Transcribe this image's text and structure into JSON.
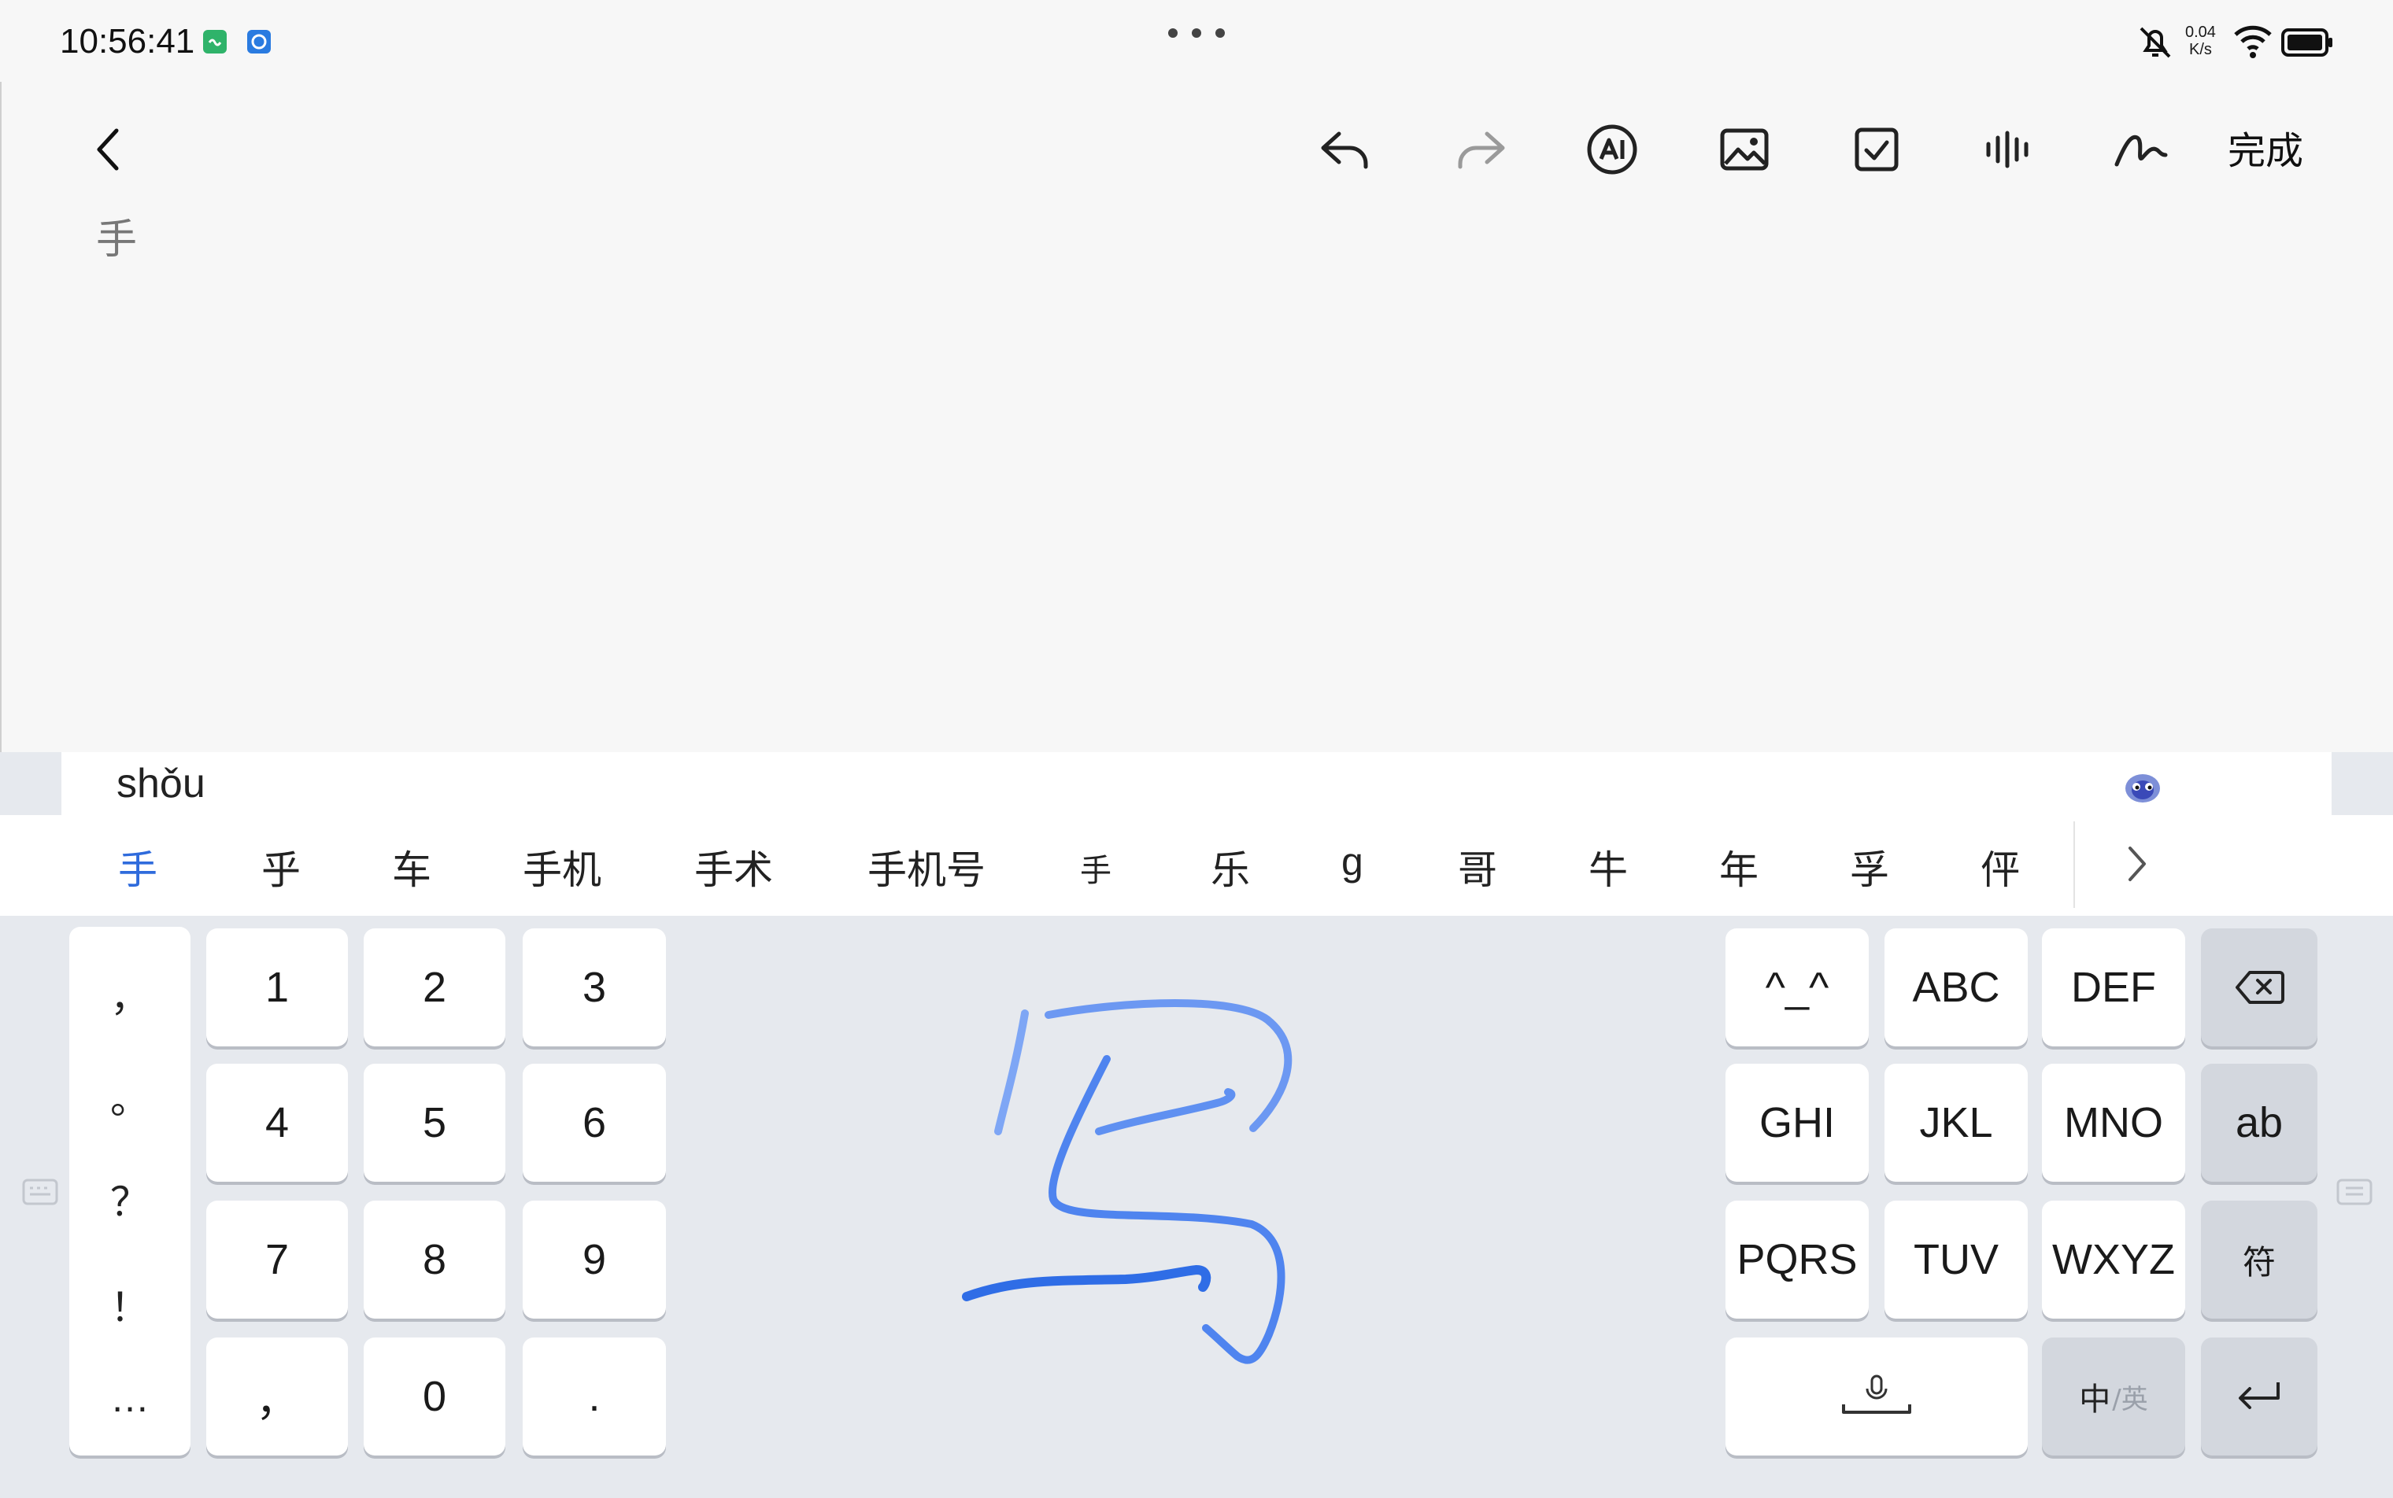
{
  "status_bar": {
    "time": "10:56:41",
    "net_speed_value": "0.04",
    "net_speed_unit": "K/s",
    "icons": [
      "app-badge-green-icon",
      "app-badge-blue-icon",
      "mute-bell-icon",
      "wifi-icon",
      "battery-icon"
    ]
  },
  "toolbar": {
    "back_icon": "chevron-left-icon",
    "tools": [
      "undo-icon",
      "redo-icon",
      "ai-icon",
      "image-icon",
      "checkbox-icon",
      "voice-wave-icon",
      "handwriting-icon"
    ],
    "done_label": "完成"
  },
  "note": {
    "text": "手"
  },
  "ime": {
    "pinyin": "shǒu",
    "assistant_icon": "ime-assistant-icon",
    "candidates": [
      "手",
      "乎",
      "车",
      "手机",
      "手术",
      "手机号",
      "手",
      "乐",
      "g",
      "哥",
      "牛",
      "年",
      "孚",
      "伻"
    ],
    "more_icon": "chevron-right-icon",
    "punctuation": [
      "，",
      "。",
      "？",
      "！",
      "…"
    ],
    "num_keys": [
      "1",
      "2",
      "3",
      "4",
      "5",
      "6",
      "7",
      "8",
      "9",
      "，",
      "0",
      "."
    ],
    "letter_keys": [
      "^_^",
      "ABC",
      "DEF",
      "GHI",
      "JKL",
      "MNO",
      "PQRS",
      "TUV",
      "WXYZ"
    ],
    "ab_label": "ab",
    "symbol_label": "符",
    "lang_main": "中",
    "lang_sub": "/英",
    "backspace_icon": "backspace-icon",
    "enter_icon": "enter-icon",
    "space_icon": "space-mic-icon",
    "handwriting_ink_color": "#3d7cf0"
  },
  "colors": {
    "accent": "#2f6bdc",
    "keyboard_bg": "#e6e9ee",
    "key_bg": "#ffffff",
    "func_key_bg": "#d3d7de"
  }
}
